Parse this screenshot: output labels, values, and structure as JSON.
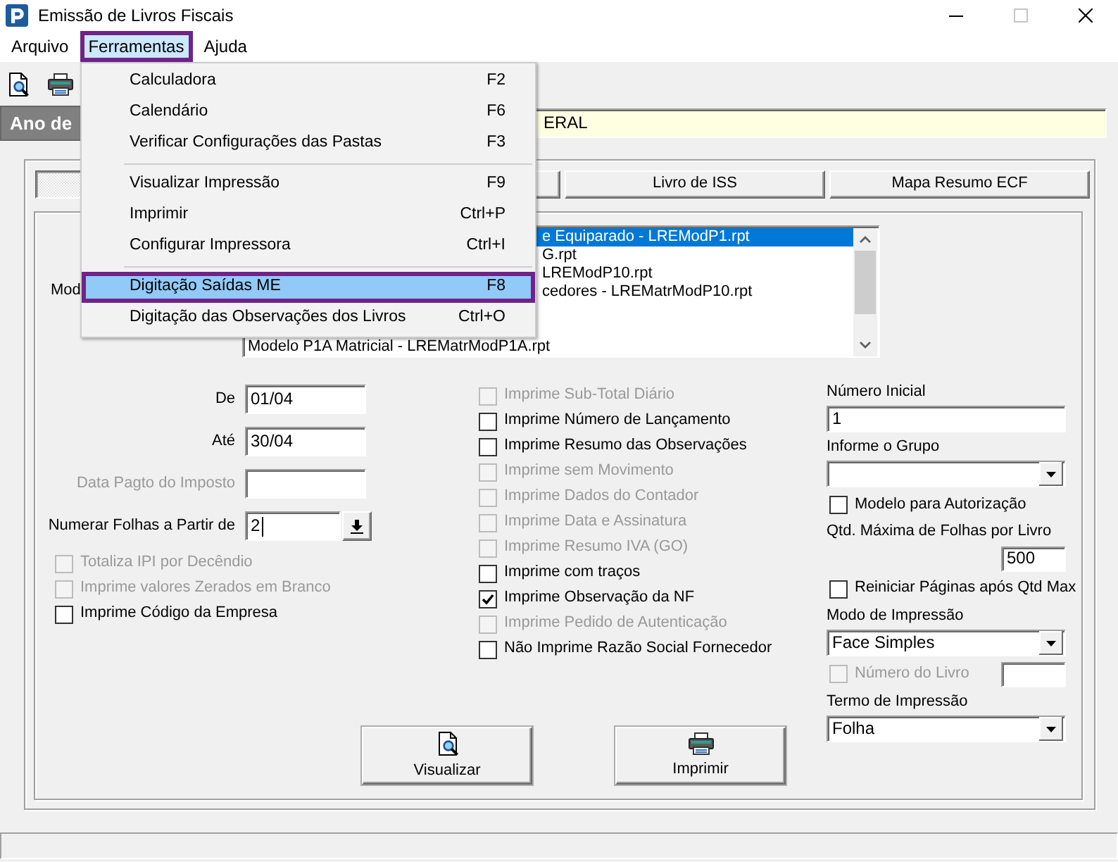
{
  "window": {
    "title": "Emissão de Livros Fiscais",
    "maximize_enabled": false
  },
  "menu_bar": [
    {
      "label": "Arquivo",
      "selected": false
    },
    {
      "label": "Ferramentas",
      "selected": true
    },
    {
      "label": "Ajuda",
      "selected": false
    }
  ],
  "open_menu": {
    "sections": [
      {
        "items": [
          {
            "label": "Calculadora",
            "shortcut": "F2",
            "selected": false
          },
          {
            "label": "Calendário",
            "shortcut": "F6",
            "selected": false
          },
          {
            "label": "Verificar Configurações das Pastas",
            "shortcut": "F3",
            "selected": false
          }
        ]
      },
      {
        "items": [
          {
            "label": "Visualizar Impressão",
            "shortcut": "F9",
            "selected": false
          },
          {
            "label": "Imprimir",
            "shortcut": "Ctrl+P",
            "selected": false
          },
          {
            "label": "Configurar Impressora",
            "shortcut": "Ctrl+I",
            "selected": false
          }
        ]
      },
      {
        "items": [
          {
            "label": "Digitação Saídas ME",
            "shortcut": "F8",
            "selected": true
          },
          {
            "label": "Digitação das Observações dos Livros",
            "shortcut": "Ctrl+O",
            "selected": false
          }
        ]
      }
    ]
  },
  "header": {
    "label": "Ano de",
    "value": "ERAL"
  },
  "tabs": [
    {
      "selected": true
    },
    {
      "selected": false
    },
    {
      "label": "Livro de ISS",
      "selected": false
    },
    {
      "label": "Mapa Resumo ECF",
      "selected": false
    }
  ],
  "model_list": {
    "label": "Mod",
    "items": [
      {
        "text": "e Equiparado - LREModP1.rpt",
        "selected": true
      },
      {
        "text": "G.rpt",
        "selected": false
      },
      {
        "text": "LREModP10.rpt",
        "selected": false
      },
      {
        "text": "cedores - LREMatrModP10.rpt",
        "selected": false
      },
      {
        "text": "Modelo P1A Matricial - LREMatrModP1A.rpt",
        "selected": false
      }
    ]
  },
  "period_fields": [
    {
      "kind": "text",
      "label": "De",
      "value": "01/04",
      "disabled": false,
      "focused": false
    },
    {
      "kind": "text",
      "label": "Até",
      "value": "30/04",
      "disabled": false,
      "focused": false
    },
    {
      "kind": "text",
      "label": "Data Pagto do Imposto",
      "disabled": true,
      "focused": false
    },
    {
      "kind": "spin",
      "label": "Numerar Folhas a Partir de",
      "value": "2",
      "disabled": false,
      "focused": true
    }
  ],
  "left_options": [
    {
      "label": "Totaliza IPI por Decêndio",
      "checked": false,
      "disabled": true
    },
    {
      "label": "Imprime valores Zerados em Branco",
      "checked": false,
      "disabled": true
    },
    {
      "label": "Imprime Código da Empresa",
      "checked": false,
      "disabled": false
    }
  ],
  "print_options": [
    {
      "label": "Imprime Sub-Total Diário",
      "checked": false,
      "disabled": true
    },
    {
      "label": "Imprime Número de Lançamento",
      "checked": false,
      "disabled": false
    },
    {
      "label": "Imprime Resumo das Observações",
      "checked": false,
      "disabled": false
    },
    {
      "label": "Imprime sem Movimento",
      "checked": false,
      "disabled": true
    },
    {
      "label": "Imprime Dados do Contador",
      "checked": false,
      "disabled": true
    },
    {
      "label": "Imprime Data e Assinatura",
      "checked": false,
      "disabled": true
    },
    {
      "label": "Imprime Resumo IVA (GO)",
      "checked": false,
      "disabled": true
    },
    {
      "label": "Imprime com traços",
      "checked": false,
      "disabled": false
    },
    {
      "label": "Imprime Observação da NF",
      "checked": true,
      "disabled": false
    },
    {
      "label": "Imprime Pedido de Autenticação",
      "checked": false,
      "disabled": true
    },
    {
      "label": "Não Imprime Razão Social Fornecedor",
      "checked": false,
      "disabled": false
    }
  ],
  "right_panel": [
    {
      "kind": "text_field",
      "label": "Número Inicial",
      "value": "1"
    },
    {
      "kind": "combo",
      "label": "Informe o Grupo"
    },
    {
      "kind": "checkbox",
      "label": "Modelo para Autorização",
      "checked": false,
      "disabled": false
    },
    {
      "kind": "number_field",
      "label": "Qtd. Máxima de Folhas por Livro",
      "value": "500"
    },
    {
      "kind": "checkbox",
      "label": "Reiniciar Páginas após Qtd Max",
      "checked": false,
      "disabled": false
    },
    {
      "kind": "combo",
      "label": "Modo de Impressão",
      "value": "Face Simples"
    },
    {
      "kind": "checkbox_field",
      "label": "Número do Livro",
      "checked": false,
      "disabled": true
    },
    {
      "kind": "combo",
      "label": "Termo de Impressão",
      "value": "Folha"
    }
  ],
  "buttons": [
    {
      "kind": "preview",
      "label": "Visualizar"
    },
    {
      "kind": "print",
      "label": "Imprimir"
    }
  ]
}
